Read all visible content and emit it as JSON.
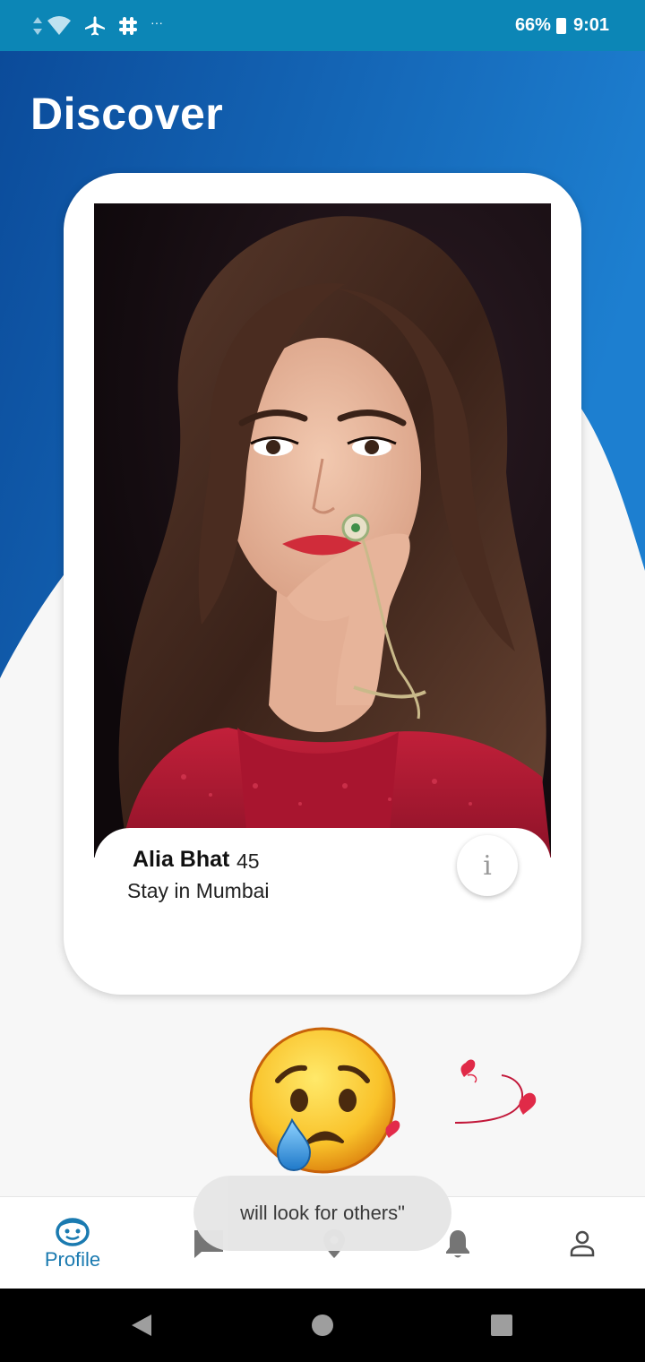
{
  "status_bar": {
    "battery": "66%",
    "time": "9:01",
    "icons": [
      "data-arrows-icon",
      "wifi-icon",
      "airplane-mode-icon",
      "slack-icon",
      "more-notifications-icon"
    ],
    "overflow": "···",
    "color": "#0c86b6"
  },
  "page": {
    "title": "Discover",
    "header_gradient": [
      "#0b4b9a",
      "#1d7fd0"
    ]
  },
  "profile_card": {
    "name": "Alia Bhat",
    "age": "45",
    "location": "Stay in Mumbai",
    "info_button": "i"
  },
  "reaction": {
    "emoji": "sad-crying-face-icon",
    "hearts": "floating-hearts-icon"
  },
  "toast": {
    "message": "will look for others\""
  },
  "bottom_nav": {
    "items": [
      {
        "label": "Profile",
        "icon": "face-icon",
        "active": true,
        "color": "#1a7ab0"
      },
      {
        "label": "",
        "icon": "chat-icon",
        "active": false
      },
      {
        "label": "",
        "icon": "location-pin-icon",
        "active": false
      },
      {
        "label": "",
        "icon": "bell-icon",
        "active": false
      },
      {
        "label": "",
        "icon": "person-icon",
        "active": false
      }
    ]
  },
  "system_nav": [
    "back-icon",
    "home-icon",
    "recents-icon"
  ]
}
